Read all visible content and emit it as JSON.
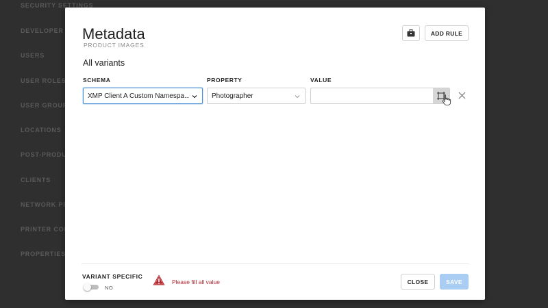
{
  "background_sidebar": {
    "items": [
      "SECURITY SETTINGS",
      "DEVELOPER",
      "USERS",
      "USER ROLES",
      "USER GROUPS",
      "LOCATIONS",
      "POST-PRODUCT",
      "CLIENTS",
      "NETWORK PRI",
      "PRINTER CONF",
      "PROPERTIES"
    ]
  },
  "modal": {
    "title": "Metadata",
    "subtitle": "PRODUCT IMAGES",
    "add_rule_label": "ADD RULE",
    "briefcase_icon": "briefcase-icon",
    "section_title": "All variants",
    "columns": {
      "schema": "SCHEMA",
      "property": "PROPERTY",
      "value": "VALUE"
    },
    "row": {
      "schema_value": "XMP Client A Custom Namespa...",
      "property_value": "Photographer",
      "value_value": "",
      "value_picker_icon": "frame-select-icon",
      "remove_icon": "close-icon"
    },
    "footer": {
      "variant_specific_label": "VARIANT SPECIFIC",
      "toggle_state": "NO",
      "warning_text": "Please fill all value",
      "close_label": "CLOSE",
      "save_label": "SAVE"
    }
  },
  "colors": {
    "primary": "#4a90d9",
    "save_disabled": "#a9cdf3",
    "warning": "#b3262d"
  }
}
